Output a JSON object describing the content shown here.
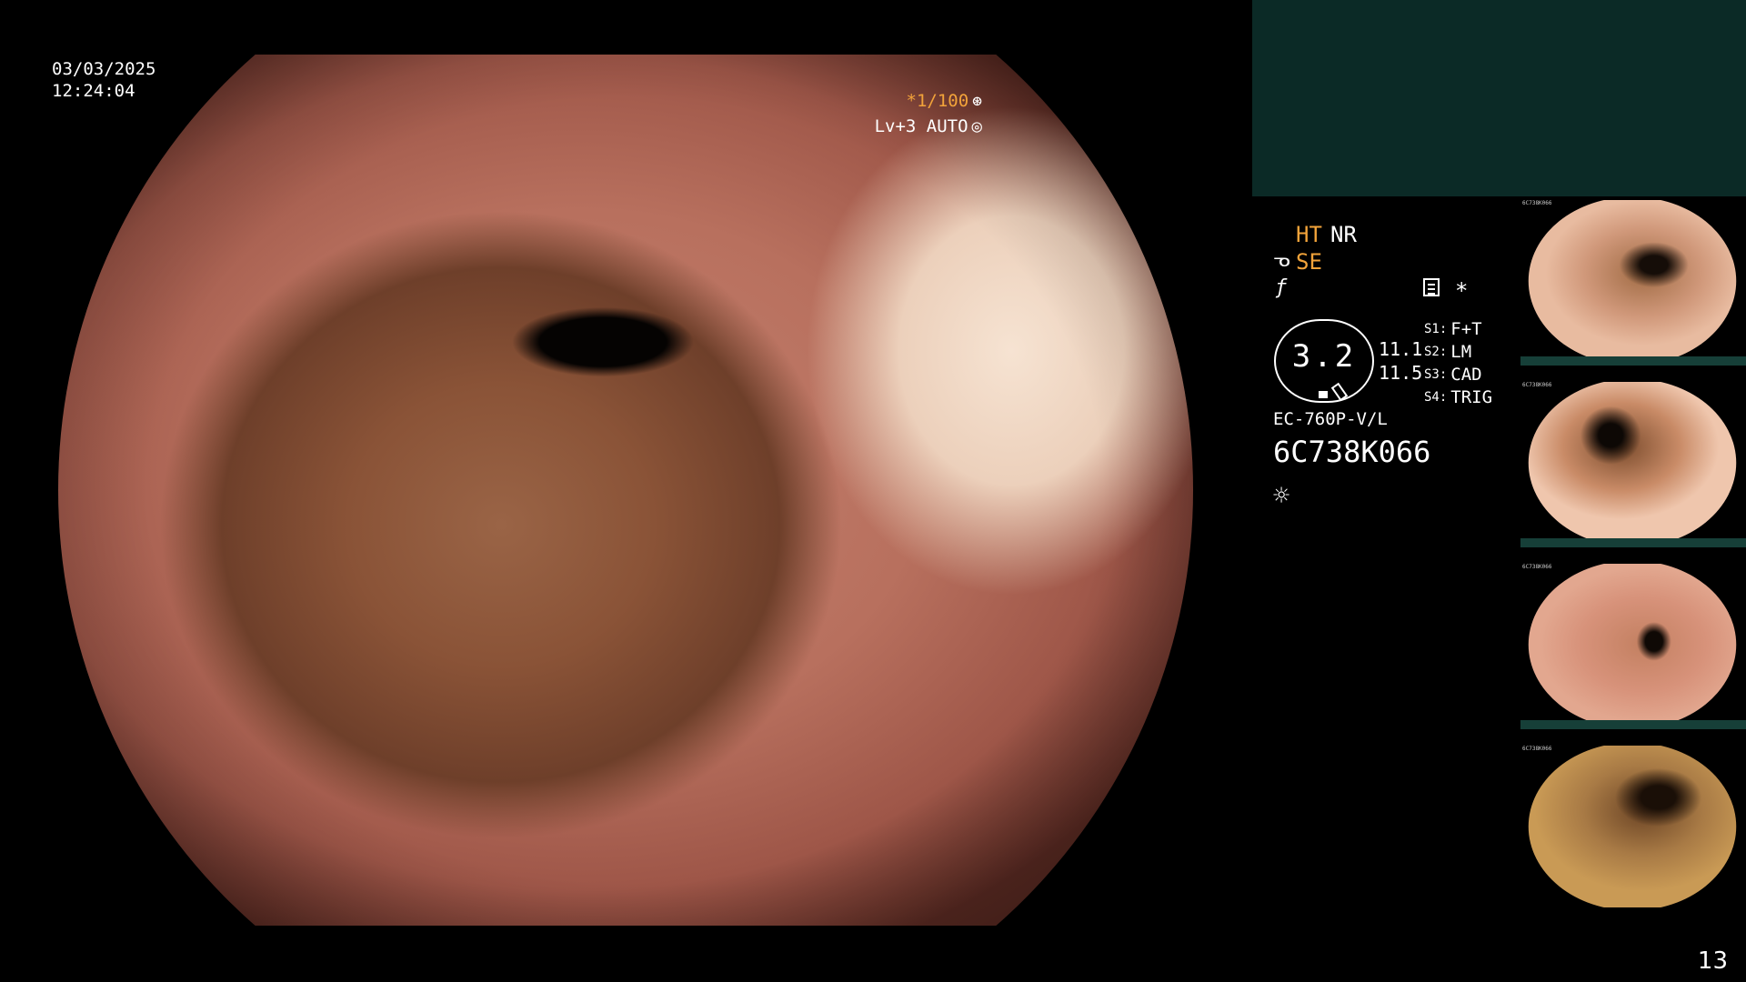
{
  "overlay": {
    "date": "03/03/2025",
    "time": "12:24:04",
    "exposure": "*1/100",
    "exposure_icon": "shutter-icon",
    "level": "Lv+3 AUTO",
    "level_icon": "iris-icon"
  },
  "status_panel": {
    "ht": "HT",
    "nr": "NR",
    "se": "SE",
    "zoom_value": "3.2",
    "value_a": "11.1",
    "value_b": "11.5",
    "switches": [
      {
        "key": "S1:",
        "value": "F+T"
      },
      {
        "key": "S2:",
        "value": "LM"
      },
      {
        "key": "S3:",
        "value": "CAD"
      },
      {
        "key": "S4:",
        "value": "TRIG"
      }
    ],
    "scope_model": "EC-760P-V/L",
    "scope_serial": "6C738K066",
    "star": "*"
  },
  "thumbnails": [
    {
      "serial": "6C738K066"
    },
    {
      "serial": "6C738K066"
    },
    {
      "serial": "6C738K066"
    },
    {
      "serial": "6C738K066"
    }
  ],
  "page_number": "13",
  "colors": {
    "accent_orange": "#f2a33a",
    "panel_green": "#0b2a26",
    "background": "#000000"
  }
}
